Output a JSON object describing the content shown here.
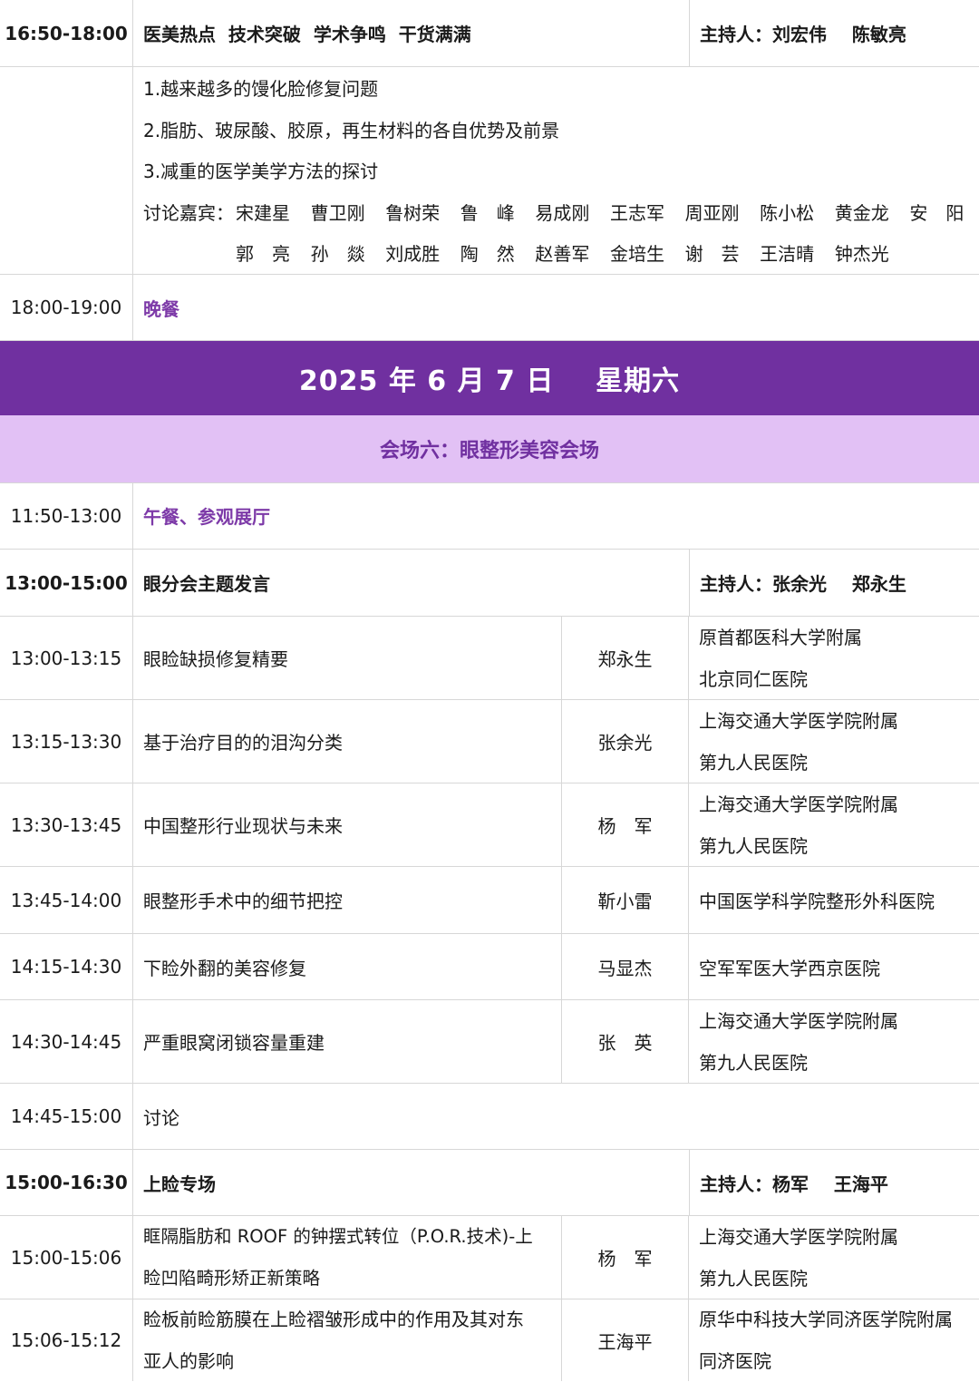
{
  "top_session": {
    "time": "16:50-18:00",
    "title": "医美热点  技术突破  学术争鸣  干货满满",
    "host": "主持人：刘宏伟    陈敏亮"
  },
  "discussion": {
    "items": [
      "1.越来越多的馒化脸修复问题",
      "2.脂肪、玻尿酸、胶原，再生材料的各自优势及前景",
      "3.减重的医学美学方法的探讨"
    ],
    "guests_label": "讨论嘉宾：",
    "guests_row1": [
      "宋建星",
      "曹卫刚",
      "鲁树荣",
      "鲁　峰",
      "易成刚",
      "王志军",
      "周亚刚",
      "陈小松",
      "黄金龙",
      "安　阳"
    ],
    "guests_row2": [
      "郭　亮",
      "孙　燚",
      "刘成胜",
      "陶　然",
      "赵善军",
      "金培生",
      "谢　芸",
      "王洁晴",
      "钟杰光"
    ]
  },
  "dinner": {
    "time": "18:00-19:00",
    "label": "晚餐"
  },
  "date_banner": "2025 年 6 月 7 日    星期六",
  "venue_banner": "会场六：眼整形美容会场",
  "lunch": {
    "time": "11:50-13:00",
    "label": "午餐、参观展厅"
  },
  "session_eye": {
    "time": "13:00-15:00",
    "title": "眼分会主题发言",
    "host": "主持人：张余光    郑永生"
  },
  "talks_eye": [
    {
      "time": "13:00-13:15",
      "topic": [
        "眼睑缺损修复精要"
      ],
      "speaker": "郑永生",
      "inst": [
        "原首都医科大学附属",
        "北京同仁医院"
      ]
    },
    {
      "time": "13:15-13:30",
      "topic": [
        "基于治疗目的的泪沟分类"
      ],
      "speaker": "张余光",
      "inst": [
        "上海交通大学医学院附属",
        "第九人民医院"
      ]
    },
    {
      "time": "13:30-13:45",
      "topic": [
        "中国整形行业现状与未来"
      ],
      "speaker": "杨　军",
      "inst": [
        "上海交通大学医学院附属",
        "第九人民医院"
      ]
    },
    {
      "time": "13:45-14:00",
      "topic": [
        "眼整形手术中的细节把控"
      ],
      "speaker": "靳小雷",
      "inst": [
        "中国医学科学院整形外科医院"
      ]
    },
    {
      "time": "14:15-14:30",
      "topic": [
        "下睑外翻的美容修复"
      ],
      "speaker": "马显杰",
      "inst": [
        "空军军医大学西京医院"
      ]
    },
    {
      "time": "14:30-14:45",
      "topic": [
        "严重眼窝闭锁容量重建"
      ],
      "speaker": "张　英",
      "inst": [
        "上海交通大学医学院附属",
        "第九人民医院"
      ]
    }
  ],
  "discuss_row": {
    "time": "14:45-15:00",
    "label": "讨论"
  },
  "session_upper": {
    "time": "15:00-16:30",
    "title": "上睑专场",
    "host": "主持人：杨军    王海平"
  },
  "talks_upper": [
    {
      "time": "15:00-15:06",
      "topic": [
        "眶隔脂肪和 ROOF 的钟摆式转位（P.O.R.技术)-上",
        "睑凹陷畸形矫正新策略"
      ],
      "speaker": "杨　军",
      "inst": [
        "上海交通大学医学院附属",
        "第九人民医院"
      ]
    },
    {
      "time": "15:06-15:12",
      "topic": [
        "睑板前睑筋膜在上睑褶皱形成中的作用及其对东",
        "亚人的影响"
      ],
      "speaker": "王海平",
      "inst": [
        "原华中科技大学同济医学院附属",
        "同济医院"
      ]
    }
  ]
}
